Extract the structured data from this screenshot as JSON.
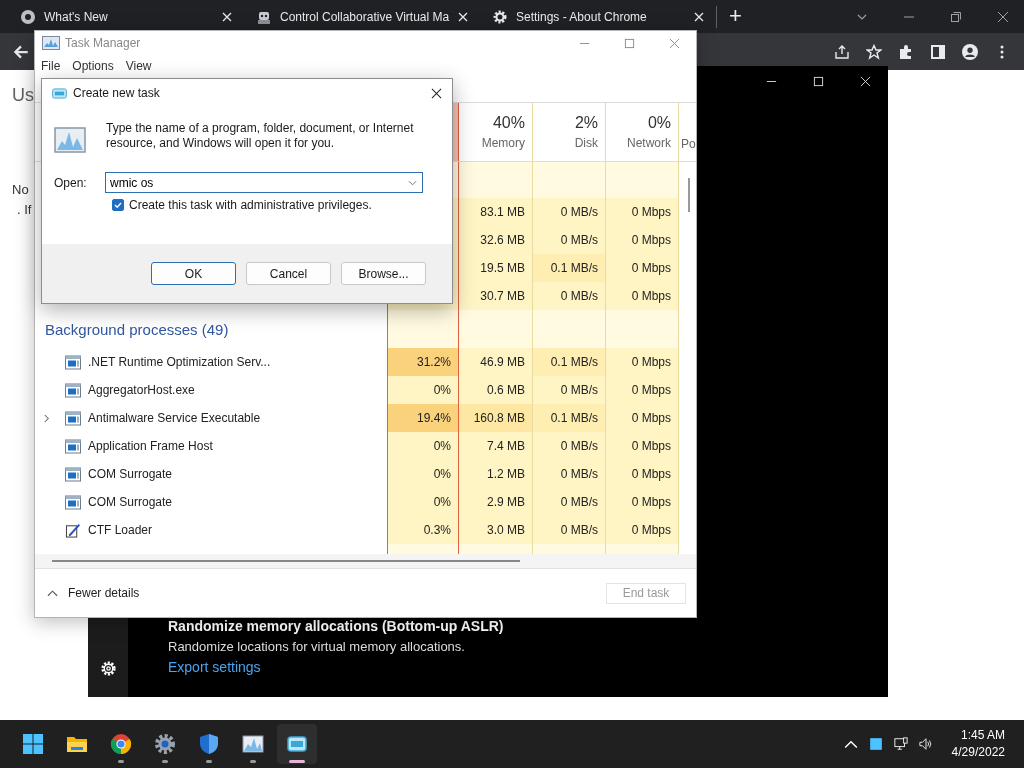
{
  "browser": {
    "tabs": [
      {
        "title": "What's New",
        "kind": "chrome",
        "selected": false
      },
      {
        "title": "Control Collaborative Virtual Ma",
        "kind": "robot",
        "selected": false
      },
      {
        "title": "Settings - About Chrome",
        "kind": "gear",
        "selected": false
      }
    ],
    "new_tab": "+",
    "page_heading": "Us",
    "page_lines": [
      "No",
      ". If"
    ]
  },
  "security_window": {
    "setting_title": "Randomize memory allocations (Bottom-up ASLR)",
    "setting_description": "Randomize locations for virtual memory allocations.",
    "link": "Export settings"
  },
  "task_manager": {
    "title": "Task Manager",
    "menu": [
      "File",
      "Options",
      "View"
    ],
    "columns": [
      {
        "percent": "40%",
        "label": "Memory"
      },
      {
        "percent": "2%",
        "label": "Disk"
      },
      {
        "percent": "0%",
        "label": "Network"
      },
      {
        "label": "Po"
      }
    ],
    "app_rows": [
      {
        "memory": "83.1 MB",
        "disk": "0 MB/s",
        "network": "0 Mbps"
      },
      {
        "memory": "32.6 MB",
        "disk": "0 MB/s",
        "network": "0 Mbps"
      },
      {
        "memory": "19.5 MB",
        "disk": "0.1 MB/s",
        "network": "0 Mbps"
      },
      {
        "memory": "30.7 MB",
        "disk": "0 MB/s",
        "network": "0 Mbps"
      }
    ],
    "group": "Background processes (49)",
    "processes": [
      {
        "name": ".NET Runtime Optimization Serv...",
        "kind": "window",
        "expandable": false,
        "cpu": "31.2%",
        "memory": "46.9 MB",
        "disk": "0.1 MB/s",
        "network": "0 Mbps"
      },
      {
        "name": "AggregatorHost.exe",
        "kind": "window",
        "expandable": false,
        "cpu": "0%",
        "memory": "0.6 MB",
        "disk": "0 MB/s",
        "network": "0 Mbps"
      },
      {
        "name": "Antimalware Service Executable",
        "kind": "window",
        "expandable": true,
        "cpu": "19.4%",
        "memory": "160.8 MB",
        "disk": "0.1 MB/s",
        "network": "0 Mbps"
      },
      {
        "name": "Application Frame Host",
        "kind": "window",
        "expandable": false,
        "cpu": "0%",
        "memory": "7.4 MB",
        "disk": "0 MB/s",
        "network": "0 Mbps"
      },
      {
        "name": "COM Surrogate",
        "kind": "window",
        "expandable": false,
        "cpu": "0%",
        "memory": "1.2 MB",
        "disk": "0 MB/s",
        "network": "0 Mbps"
      },
      {
        "name": "COM Surrogate",
        "kind": "window",
        "expandable": false,
        "cpu": "0%",
        "memory": "2.9 MB",
        "disk": "0 MB/s",
        "network": "0 Mbps"
      },
      {
        "name": "CTF Loader",
        "kind": "pen",
        "expandable": false,
        "cpu": "0.3%",
        "memory": "3.0 MB",
        "disk": "0 MB/s",
        "network": "0 Mbps"
      }
    ],
    "fewer_details": "Fewer details",
    "end_task": {
      "label": "End task",
      "disabled": true
    }
  },
  "dialog": {
    "title": "Create new task",
    "message": "Type the name of a program, folder, document, or Internet resource, and Windows will open it for you.",
    "open_label": "Open:",
    "value": "wmic os",
    "admin": {
      "label": "Create this task with administrative privileges.",
      "checked": true
    },
    "buttons": [
      {
        "label": "OK",
        "default": true
      },
      {
        "label": "Cancel",
        "default": false
      },
      {
        "label": "Browse...",
        "default": false
      }
    ]
  },
  "taskbar": {
    "apps": [
      {
        "kind": "start",
        "running": false,
        "selected": false
      },
      {
        "kind": "folder",
        "running": false,
        "selected": false
      },
      {
        "kind": "chrome",
        "running": true,
        "selected": false
      },
      {
        "kind": "gear",
        "running": true,
        "selected": false
      },
      {
        "kind": "shield",
        "running": true,
        "selected": false
      },
      {
        "kind": "monitor",
        "running": true,
        "selected": false
      },
      {
        "kind": "window",
        "running": true,
        "selected": true
      }
    ],
    "time": "1:45 AM",
    "date": "4/29/2022"
  }
}
